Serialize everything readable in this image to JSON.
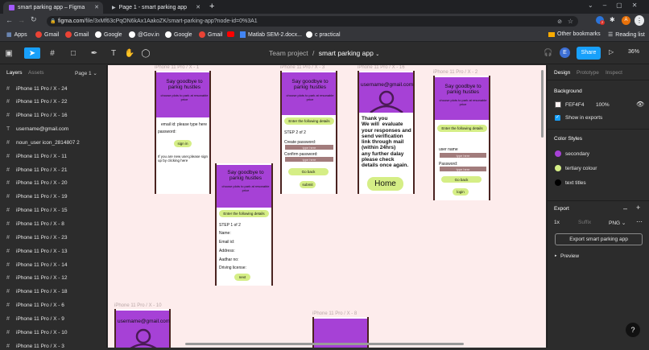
{
  "browser": {
    "tabs": [
      {
        "title": "smart parking app – Figma",
        "active": true
      },
      {
        "title": "Page 1 - smart parking app",
        "active": false
      }
    ],
    "url_host": "figma.com",
    "url_path": "/file/3xMf63cPqON6kAx1AakoZK/smart-parking-app?node-id=0%3A1",
    "bookmarks": [
      "Apps",
      "Gmail",
      "Gmail",
      "Google",
      "@Gov.in",
      "Google",
      "Gmail",
      "",
      "Matlab SEM-2.docx...",
      "c practical"
    ],
    "other_bookmarks": "Other bookmarks",
    "reading_list": "Reading list",
    "avatar_letter": "A",
    "badge_count": "2"
  },
  "figma": {
    "breadcrumb_team": "Team project",
    "separator": "/",
    "file_name": "smart parking app",
    "user_initial": "E",
    "share_label": "Share",
    "zoom": "36%"
  },
  "left_panel": {
    "tabs": [
      "Layers",
      "Assets"
    ],
    "page": "Page 1",
    "layers": [
      {
        "icon": "#",
        "name": "iPhone 11 Pro / X - 24"
      },
      {
        "icon": "#",
        "name": "iPhone 11 Pro / X - 22"
      },
      {
        "icon": "#",
        "name": "iPhone 11 Pro / X - 16"
      },
      {
        "icon": "T",
        "name": "username@gmail.com"
      },
      {
        "icon": "#",
        "name": "noun_user icon_2814807 2"
      },
      {
        "icon": "#",
        "name": "iPhone 11 Pro / X - 11"
      },
      {
        "icon": "#",
        "name": "iPhone 11 Pro / X - 21"
      },
      {
        "icon": "#",
        "name": "iPhone 11 Pro / X - 20"
      },
      {
        "icon": "#",
        "name": "iPhone 11 Pro / X - 19"
      },
      {
        "icon": "#",
        "name": "iPhone 11 Pro / X - 15"
      },
      {
        "icon": "#",
        "name": "iPhone 11 Pro / X - 8"
      },
      {
        "icon": "#",
        "name": "iPhone 11 Pro / X - 23"
      },
      {
        "icon": "#",
        "name": "iPhone 11 Pro / X - 13"
      },
      {
        "icon": "#",
        "name": "iPhone 11 Pro / X - 14"
      },
      {
        "icon": "#",
        "name": "iPhone 11 Pro / X - 12"
      },
      {
        "icon": "#",
        "name": "iPhone 11 Pro / X - 18"
      },
      {
        "icon": "#",
        "name": "iPhone 11 Pro / X - 6"
      },
      {
        "icon": "#",
        "name": "iPhone 11 Pro / X - 9"
      },
      {
        "icon": "#",
        "name": "iPhone 11 Pro / X - 10"
      },
      {
        "icon": "#",
        "name": "iPhone 11 Pro / X - 3"
      }
    ]
  },
  "canvas": {
    "bg": "#FDECEC",
    "frames": {
      "f1": {
        "label": "iPhone 11 Pro / X - 1",
        "title": "Say goodbye to parkig hustles",
        "subtitle": "choose plots to park at resonable price",
        "email": "email id: please type here",
        "password": "password:",
        "btn": "sign in",
        "note": "If you are new user,please sign up by clicking here"
      },
      "f2": {
        "label": "iPhone 11 Pro / X - 2",
        "title": "Say goodbye to parkig hustles",
        "subtitle": "choose plots to park at resonable price",
        "btn_details": "Enter the following details",
        "step": "STEP 1 of 2",
        "name": "Name:",
        "email": "Email id:",
        "address": "Address:",
        "aadhar": "Aadhar no:",
        "license": "Driving license:",
        "next": "next"
      },
      "f3": {
        "label": "iPhone 11 Pro / X - 3",
        "title": "Say goodbye to parkig hustles",
        "subtitle": "choose plots to park at resonable price",
        "btn_details": "Enter the following details",
        "step": "STEP 2 of 2",
        "create_pw": "Create password:",
        "type1": "type here",
        "confirm_pw": "Confirm password:",
        "type2": "type here",
        "goback": "Go back",
        "submit": "submit"
      },
      "f4": {
        "label": "iPhone 11 Pro / X - 16",
        "email": "username@gmail.com",
        "thanks": "Thank you\nWe will  evaluate your responses and send verification link through mail (within 24hrs)\nany further dalay please check  details once again.",
        "home": "Home"
      },
      "f5": {
        "label": "iPhone 11 Pro / X - 2",
        "title": "Say goodbye to parkig hustles",
        "subtitle": "choose plots to park at resonable price",
        "btn_details": "Enter the following details",
        "user": "user name",
        "type1": "type here",
        "password": "Password:",
        "type2": "type here",
        "goback": "Go back",
        "login": "login"
      },
      "f6": {
        "label": "iPhone 11 Pro / X - 10",
        "email": "username@gmail.com"
      },
      "f7": {
        "label": "iPhone 11 Pro / X - 8"
      }
    }
  },
  "right_panel": {
    "tabs": [
      "Design",
      "Prototype",
      "Inspect"
    ],
    "background_heading": "Background",
    "bg_hex": "FEF4F4",
    "bg_opacity": "100%",
    "show_exports": "Show in exports",
    "color_styles_heading": "Color Styles",
    "styles": [
      {
        "name": "secondary",
        "color": "#A641D6"
      },
      {
        "name": "tertiary colour",
        "color": "#D5EE86"
      },
      {
        "name": "text titles",
        "color": "#000000"
      }
    ],
    "export_heading": "Export",
    "export_scale": "1x",
    "export_suffix": "Suffix",
    "export_format": "PNG",
    "export_button": "Export smart parking app",
    "preview": "Preview",
    "help": "?"
  }
}
